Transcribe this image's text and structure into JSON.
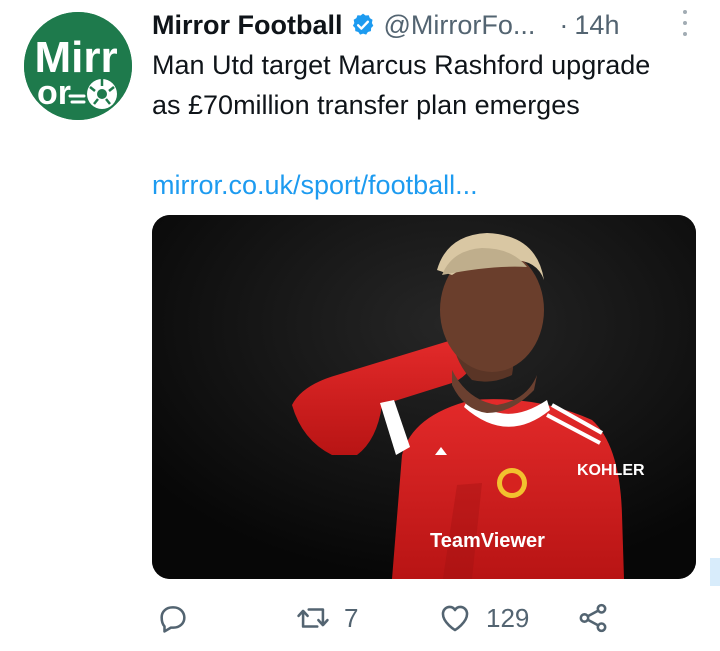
{
  "account": {
    "display_name": "Mirror Football",
    "handle": "@MirrorFo...",
    "separator": "·",
    "timestamp": "14h",
    "verified": true,
    "avatar_text_top": "Mirr",
    "avatar_text_bottom": "or",
    "brand_color": "#1e7a4c"
  },
  "tweet": {
    "text": "Man Utd target Marcus Rashford upgrade as £70million transfer plan emerges",
    "link_text": "mirror.co.uk/sport/football..."
  },
  "media": {
    "shirt_sponsor": "TeamViewer",
    "sleeve_text": "KOHLER"
  },
  "actions": {
    "reply": {
      "icon": "reply-icon"
    },
    "retweet": {
      "icon": "retweet-icon",
      "count": "7"
    },
    "like": {
      "icon": "heart-icon",
      "count": "129"
    },
    "share": {
      "icon": "share-icon"
    }
  },
  "colors": {
    "link": "#1d9bf0",
    "muted": "#536471",
    "text": "#0f1419",
    "verified": "#1d9bf0"
  }
}
